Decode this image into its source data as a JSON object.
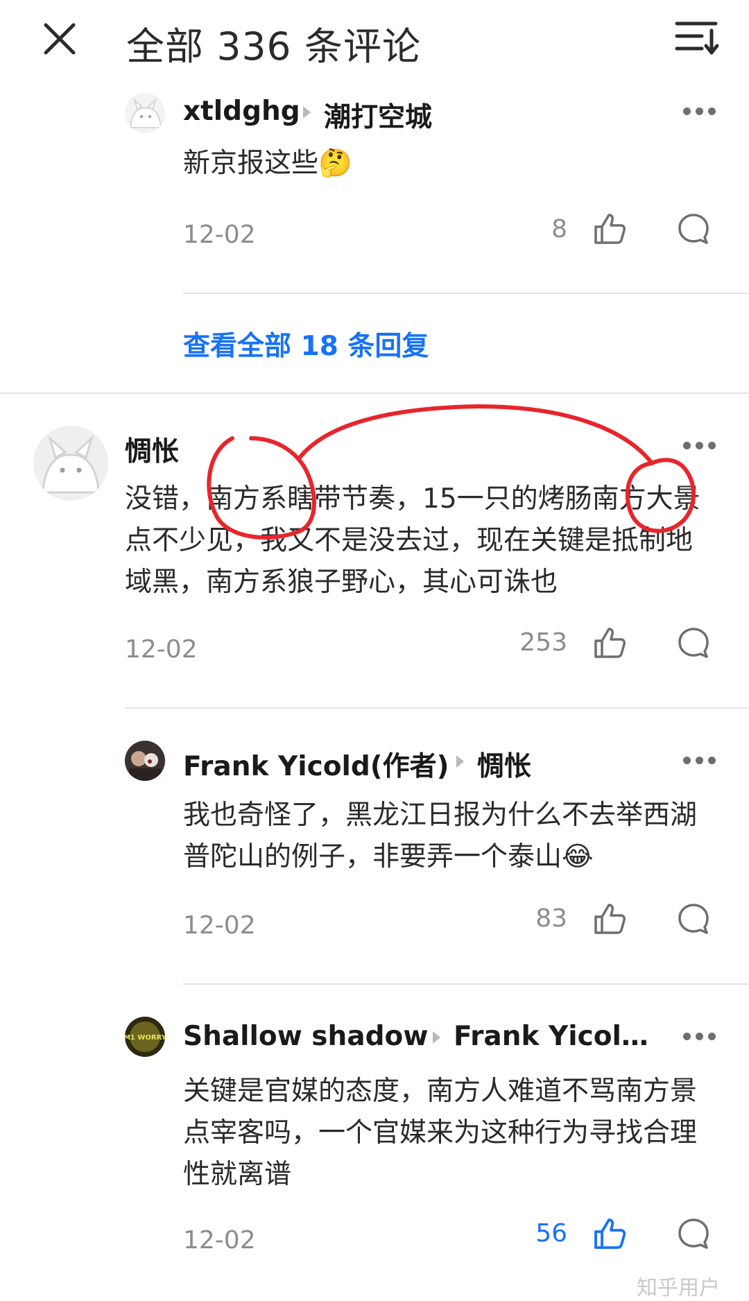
{
  "header": {
    "title": "全部 336 条评论",
    "close_icon": "close-icon",
    "sort_icon": "sort-icon"
  },
  "colors": {
    "accent": "#1772f6",
    "annotation": "#e8252c",
    "muted": "#8c8c8c"
  },
  "comments": [
    {
      "username": "xtldghg",
      "reply_to": "潮打空城",
      "text": "新京报这些🤔",
      "date": "12-02",
      "likes": "8",
      "liked": false
    },
    {
      "view_replies": "查看全部 18 条回复"
    },
    {
      "username": "惆怅",
      "text": "没错，南方系瞎带节奏，15一只的烤肠南方大景点不少见，我又不是没去过，现在关键是抵制地域黑，南方系狼子野心，其心可诛也",
      "date": "12-02",
      "likes": "253",
      "liked": false
    },
    {
      "username": "Frank Yicold(作者)",
      "reply_to": "惆怅",
      "text": "我也奇怪了，黑龙江日报为什么不去举西湖普陀山的例子，非要弄一个泰山😂",
      "date": "12-02",
      "likes": "83",
      "liked": false
    },
    {
      "username": "Shallow shadow",
      "reply_to": "Frank Yicol…",
      "avatar_text": "M1 WORRY",
      "text": "关键是官媒的态度，南方人难道不骂南方景点宰客吗，一个官媒来为这种行为寻找合理性就离谱",
      "date": "12-02",
      "likes": "56",
      "liked": true
    }
  ],
  "watermark": "知乎用户"
}
